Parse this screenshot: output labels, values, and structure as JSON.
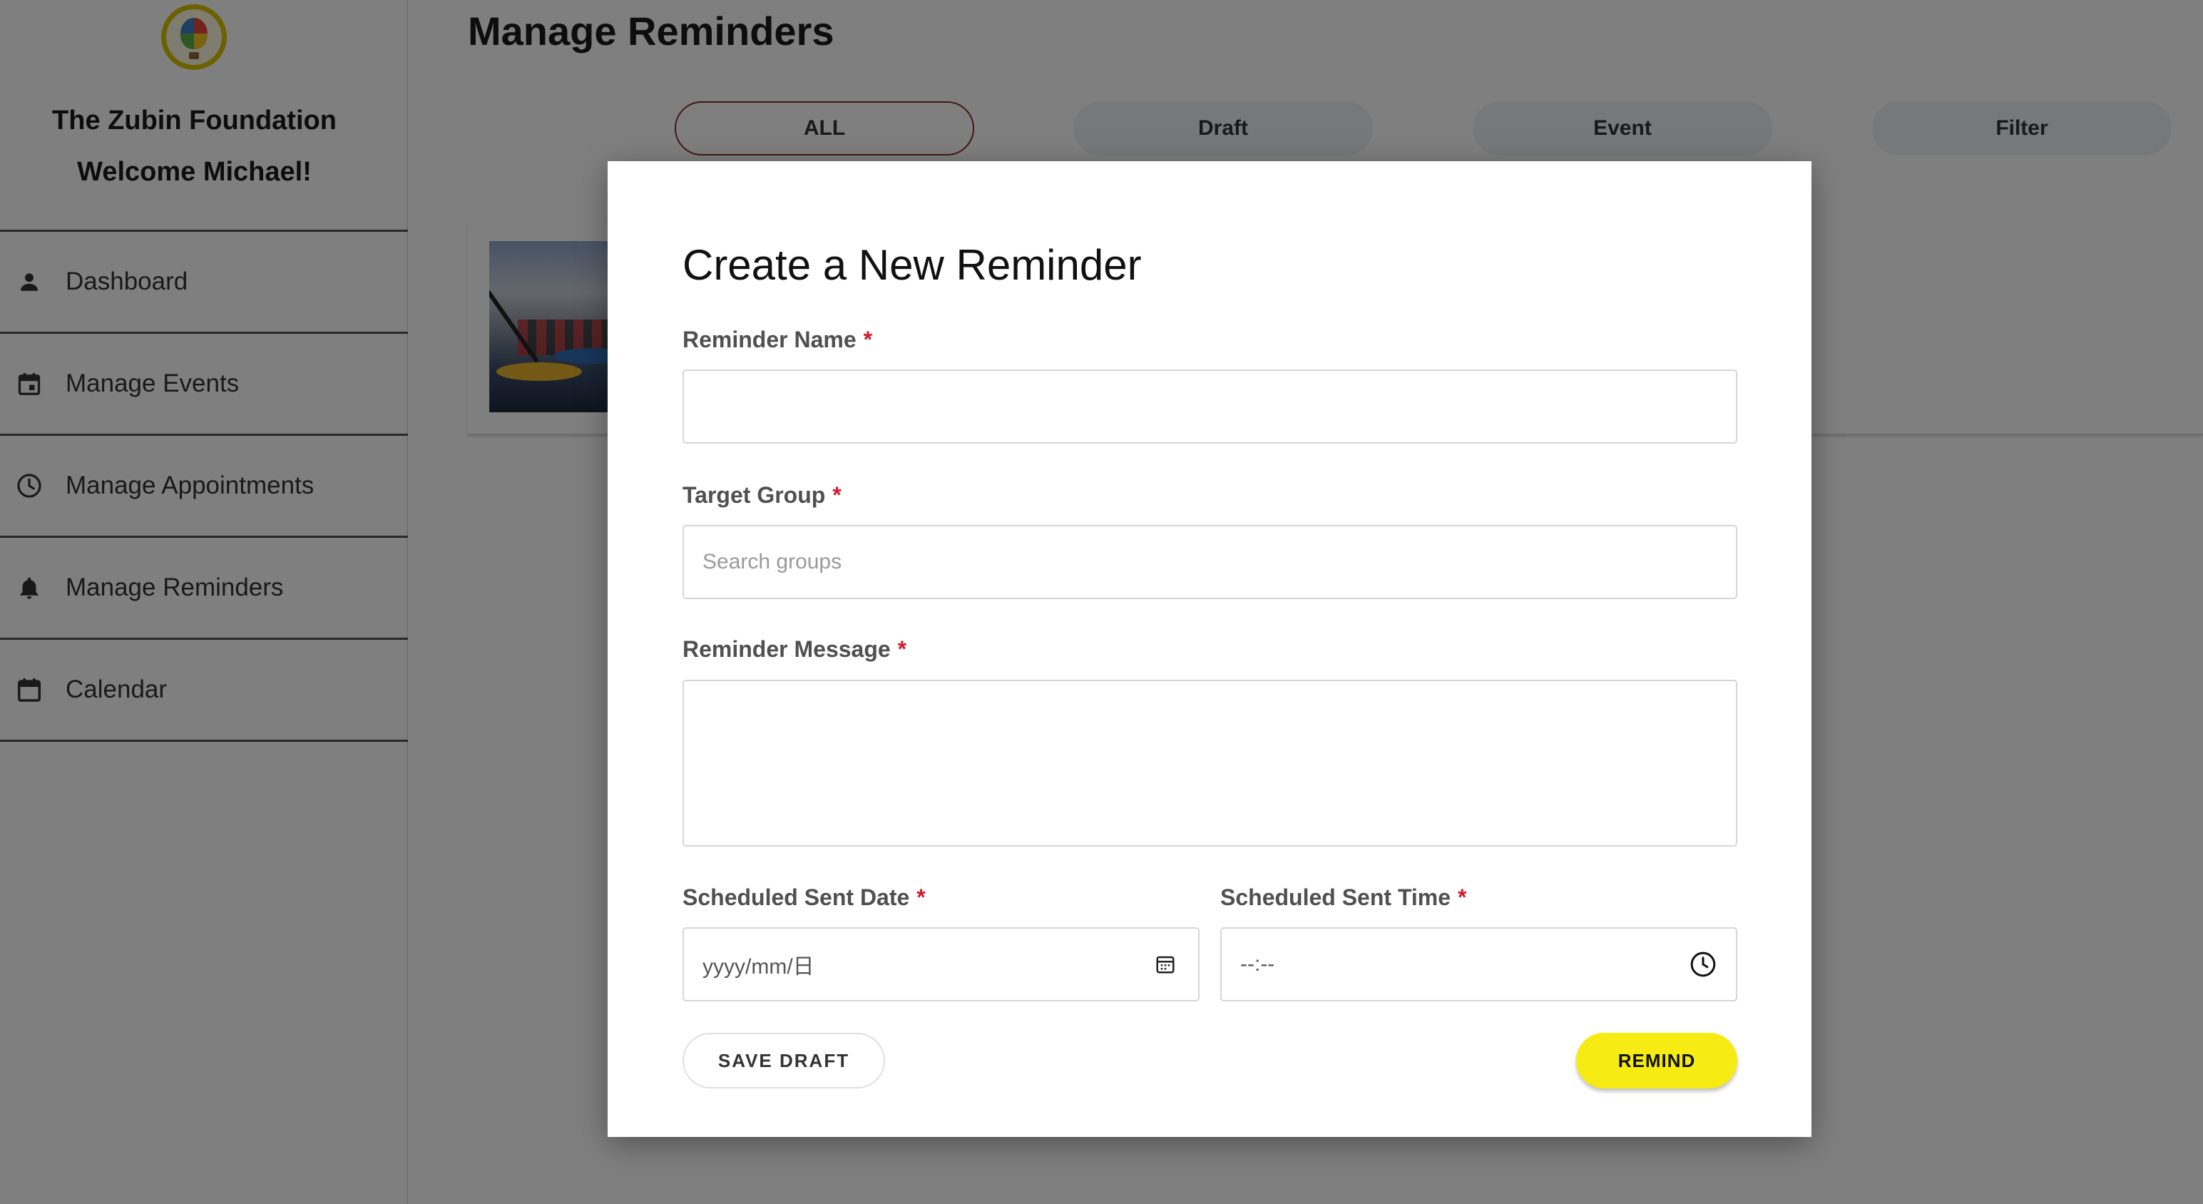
{
  "sidebar": {
    "org_name": "The Zubin Foundation",
    "welcome": "Welcome Michael!",
    "items": [
      {
        "label": "Dashboard",
        "icon": "person-icon"
      },
      {
        "label": "Manage Events",
        "icon": "event-calendar-icon"
      },
      {
        "label": "Manage Appointments",
        "icon": "clock-icon"
      },
      {
        "label": "Manage Reminders",
        "icon": "bell-icon"
      },
      {
        "label": "Calendar",
        "icon": "calendar-icon"
      }
    ]
  },
  "main": {
    "title": "Manage Reminders",
    "tabs": [
      {
        "label": "ALL",
        "active": true
      },
      {
        "label": "Draft",
        "active": false
      },
      {
        "label": "Event",
        "active": false
      },
      {
        "label": "Filter",
        "active": false
      }
    ]
  },
  "modal": {
    "title": "Create a New Reminder",
    "required_mark": "*",
    "reminder_name": {
      "label": "Reminder Name",
      "value": ""
    },
    "target_group": {
      "label": "Target Group",
      "placeholder": "Search groups"
    },
    "reminder_message": {
      "label": "Reminder Message",
      "value": ""
    },
    "sent_date": {
      "label": "Scheduled Sent Date",
      "placeholder": "yyyy/mm/日"
    },
    "sent_time": {
      "label": "Scheduled Sent Time",
      "placeholder": "--:--"
    },
    "save_draft_label": "SAVE DRAFT",
    "remind_label": "REMIND"
  },
  "colors": {
    "accent_yellow": "#f6ec13",
    "required_red": "#d11a2a",
    "active_tab_border": "#8a2a2a"
  }
}
